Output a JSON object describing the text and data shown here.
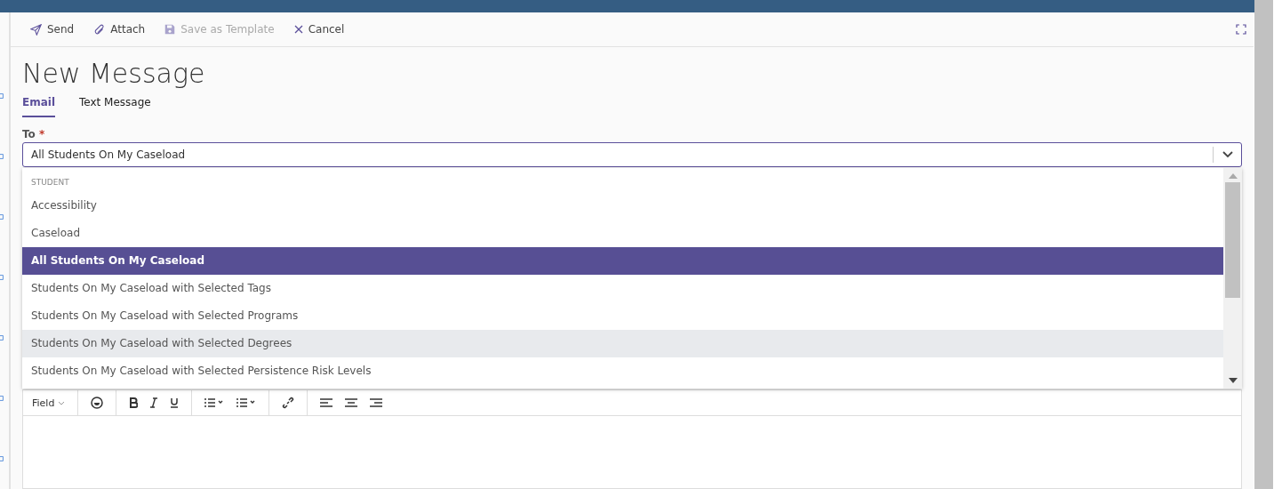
{
  "toolbar": [
    {
      "kind": "send",
      "label": "Send",
      "disabled": false
    },
    {
      "kind": "attach",
      "label": "Attach",
      "disabled": false
    },
    {
      "kind": "save",
      "label": "Save as Template",
      "disabled": true
    },
    {
      "kind": "cancel",
      "label": "Cancel",
      "disabled": false
    }
  ],
  "title": "New Message",
  "tabs": [
    {
      "label": "Email",
      "selected": true
    },
    {
      "label": "Text Message",
      "selected": false
    }
  ],
  "to": {
    "label": "To",
    "required_mark": "*",
    "value": "All Students On My Caseload",
    "expanded": true
  },
  "dropdown": {
    "group": "STUDENT",
    "options": [
      {
        "label": "Accessibility",
        "selected": false,
        "hovered": false
      },
      {
        "label": "Caseload",
        "selected": false,
        "hovered": false
      },
      {
        "label": "All Students On My Caseload",
        "selected": true,
        "hovered": false
      },
      {
        "label": "Students On My Caseload with Selected Tags",
        "selected": false,
        "hovered": false
      },
      {
        "label": "Students On My Caseload with Selected Programs",
        "selected": false,
        "hovered": false
      },
      {
        "label": "Students On My Caseload with Selected Degrees",
        "selected": false,
        "hovered": true
      },
      {
        "label": "Students On My Caseload with Selected Persistence Risk Levels",
        "selected": false,
        "hovered": false
      }
    ]
  },
  "editor": {
    "field_menu": "Field"
  }
}
